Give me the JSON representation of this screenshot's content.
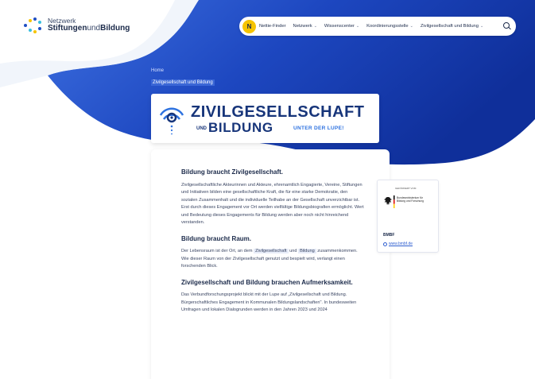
{
  "logo": {
    "line1": "Netzwerk",
    "line2a": "Stiftungen",
    "line2b": "und",
    "line2c": "Bildung"
  },
  "nav": {
    "nettie_badge": "N",
    "items": [
      {
        "label": "Nettie-Finder",
        "has_chevron": false
      },
      {
        "label": "Netzwerk",
        "has_chevron": true
      },
      {
        "label": "Wissenscenter",
        "has_chevron": true
      },
      {
        "label": "Koordinierungsstelle",
        "has_chevron": true
      },
      {
        "label": "Zivilgesellschaft und Bildung",
        "has_chevron": true
      }
    ],
    "search_icon": "search-icon"
  },
  "breadcrumb": {
    "home": "Home",
    "current": "Zivilgesellschaft und Bildung"
  },
  "hero": {
    "title_line1": "ZIVILGESELLSCHAFT",
    "und": "UND",
    "title_line2": "BILDUNG",
    "tagline": "UNTER DER LUPE!"
  },
  "content": {
    "sections": [
      {
        "heading": "Bildung braucht Zivilgesellschaft.",
        "text": "Zivilgesellschaftliche Akteurinnen und Akteure, ehrenamtlich Engagierte, Vereine, Stiftungen und Initiativen bilden eine gesellschaftliche Kraft, die für eine starke Demokratie, den sozialen Zusammenhalt und die individuelle Teilhabe an der Gesellschaft unverzichtbar ist. Erst durch dieses Engagement vor Ort werden vielfältige Bildungsbiografien ermöglicht. Wert und Bedeutung dieses Engagements für Bildung werden aber noch nicht hinreichend verstanden."
      },
      {
        "heading": "Bildung braucht Raum.",
        "text_a": "Der Lebensraum ist der Ort, an dem",
        "hl1": "Zivilgesellschaft",
        "text_b": "und",
        "hl2": "Bildung",
        "text_c": "zusammenkommen. Wie dieser Raum von der Zivilgesellschaft genutzt und bespielt wird, verlangt einen forschenden Blick."
      },
      {
        "heading": "Zivilgesellschaft und Bildung brauchen Aufmerksamkeit.",
        "text": "Das Verbundforschungsprojekt blickt mit der Lupe auf „Zivilgesellschaft und Bildung. Bürgerschaftliches Engagement in Kommunalen Bildungslandschaften\". In bundesweiten Umfragen und lokalen Dialogrunden werden in den Jahren 2023 und 2024"
      }
    ]
  },
  "sponsor": {
    "label": "GEFÖRDERT VOM",
    "ministry": "Bundesministerium für Bildung und Forschung",
    "short": "BMBF",
    "link": "www.bmbf.de"
  },
  "colors": {
    "brand_blue": "#1f4fc4",
    "deep_blue": "#17357a",
    "accent_yellow": "#f6c400",
    "link_blue": "#2f5fd0"
  }
}
